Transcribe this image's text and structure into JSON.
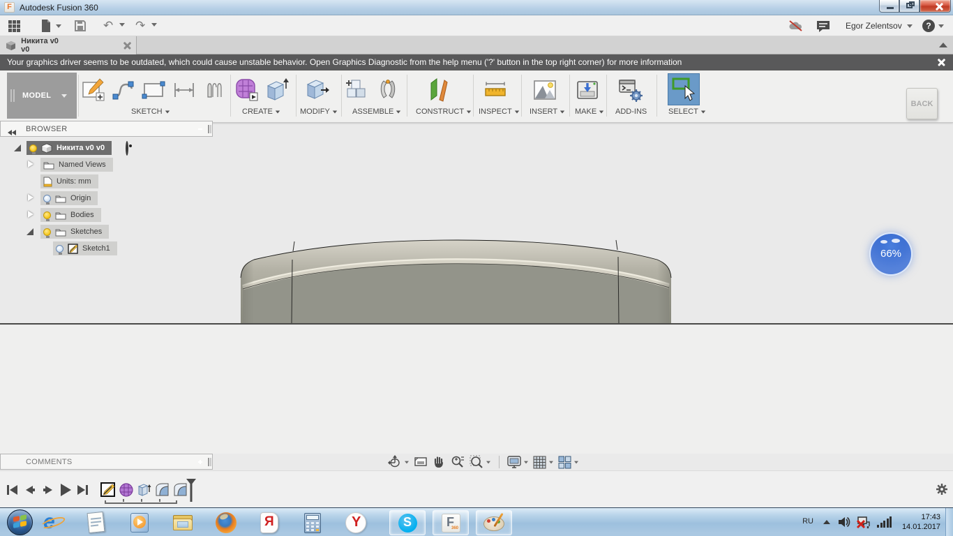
{
  "window": {
    "title": "Autodesk Fusion 360"
  },
  "quickbar": {
    "user": "Egor Zelentsov",
    "help_glyph": "?"
  },
  "tab": {
    "label": "Никита v0 v0"
  },
  "warning": {
    "text": "Your graphics driver seems to be outdated, which could cause unstable behavior. Open Graphics Diagnostic from the help menu ('?' button in the top right corner) for more information"
  },
  "ribbon": {
    "workspace": "MODEL",
    "back_label": "BACK",
    "groups": [
      {
        "label": "SKETCH"
      },
      {
        "label": "CREATE"
      },
      {
        "label": "MODIFY"
      },
      {
        "label": "ASSEMBLE"
      },
      {
        "label": "CONSTRUCT"
      },
      {
        "label": "INSPECT"
      },
      {
        "label": "INSERT"
      },
      {
        "label": "MAKE"
      },
      {
        "label": "ADD-INS"
      },
      {
        "label": "SELECT"
      }
    ]
  },
  "browser": {
    "title": "BROWSER",
    "tree": [
      {
        "label": "Никита v0 v0",
        "selected": true
      },
      {
        "label": "Named Views"
      },
      {
        "label": "Units: mm"
      },
      {
        "label": "Origin"
      },
      {
        "label": "Bodies"
      },
      {
        "label": "Sketches"
      },
      {
        "label": "Sketch1"
      }
    ]
  },
  "viewport": {
    "progress_label": "66%"
  },
  "comments": {
    "title": "COMMENTS"
  },
  "taskbar": {
    "glyphs": {
      "ie": "e",
      "yandex_browser": "Я",
      "yandex": "Y",
      "skype": "S",
      "fusion": "F",
      "fusion_sub": "360"
    },
    "tray": {
      "lang": "RU",
      "time": "17:43",
      "date": "14.01.2017"
    }
  },
  "colors": {
    "select_active": "#6a9ac8",
    "warning_bg": "#59595a",
    "badge_blue": "#3567cd",
    "taskbar_blue": "#aecbe6"
  }
}
